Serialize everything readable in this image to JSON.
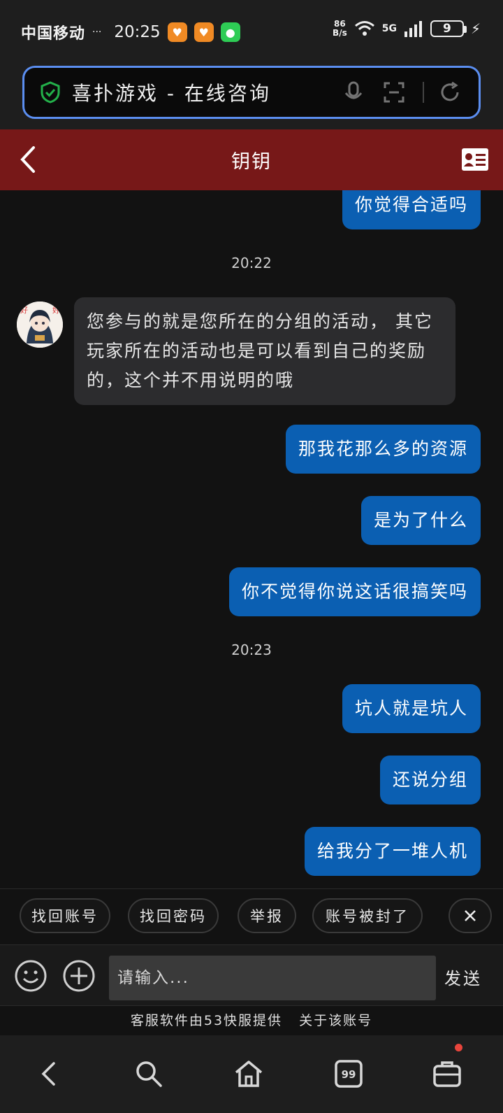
{
  "status_bar": {
    "carrier": "中国移动",
    "carrier_suffix": "···",
    "time": "20:25",
    "net_speed_value": "86",
    "net_speed_unit": "B/s",
    "network": "5G",
    "battery": "9"
  },
  "browser": {
    "url_title": "喜扑游戏 - 在线咨询"
  },
  "chat_header": {
    "title": "钥钥"
  },
  "messages": [
    {
      "type": "out",
      "text": "你觉得合适吗"
    },
    {
      "type": "time",
      "text": "20:22"
    },
    {
      "type": "in",
      "text": "您参与的就是您所在的分组的活动，  其它玩家所在的活动也是可以看到自己的奖励的，这个并不用说明的哦"
    },
    {
      "type": "out",
      "text": "那我花那么多的资源"
    },
    {
      "type": "out",
      "text": "是为了什么"
    },
    {
      "type": "out",
      "text": "你不觉得你说这话很搞笑吗"
    },
    {
      "type": "time",
      "text": "20:23"
    },
    {
      "type": "out",
      "text": "坑人就是坑人"
    },
    {
      "type": "out",
      "text": "还说分组"
    },
    {
      "type": "out",
      "text": "给我分了一堆人机"
    }
  ],
  "quick_replies": [
    "找回账号",
    "找回密码",
    "举报",
    "账号被封了"
  ],
  "input": {
    "placeholder": "请输入...",
    "send_label": "发送"
  },
  "footer": {
    "provider": "客服软件由53快服提供",
    "about": "关于该账号"
  },
  "colors": {
    "header_bg": "#771818",
    "outgoing_bubble": "#0b5fb2",
    "incoming_bubble": "#2c2c2e",
    "url_border": "#5b8ef0"
  }
}
